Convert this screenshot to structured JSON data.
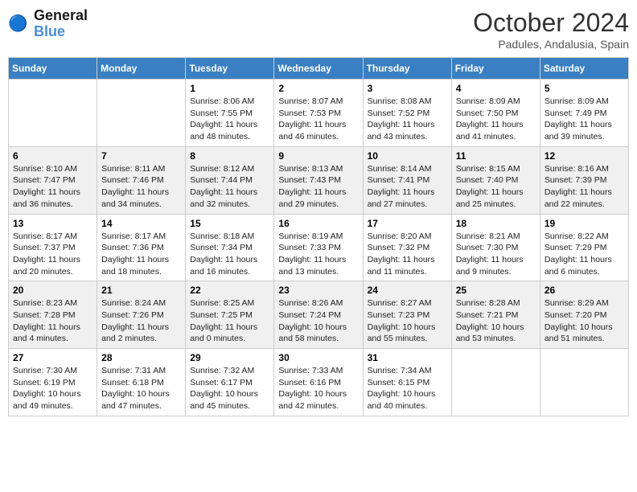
{
  "header": {
    "logo": {
      "line1": "General",
      "line2": "Blue"
    },
    "title": "October 2024",
    "location": "Padules, Andalusia, Spain"
  },
  "days_of_week": [
    "Sunday",
    "Monday",
    "Tuesday",
    "Wednesday",
    "Thursday",
    "Friday",
    "Saturday"
  ],
  "weeks": [
    [
      {
        "num": "",
        "info": ""
      },
      {
        "num": "",
        "info": ""
      },
      {
        "num": "1",
        "info": "Sunrise: 8:06 AM\nSunset: 7:55 PM\nDaylight: 11 hours and 48 minutes."
      },
      {
        "num": "2",
        "info": "Sunrise: 8:07 AM\nSunset: 7:53 PM\nDaylight: 11 hours and 46 minutes."
      },
      {
        "num": "3",
        "info": "Sunrise: 8:08 AM\nSunset: 7:52 PM\nDaylight: 11 hours and 43 minutes."
      },
      {
        "num": "4",
        "info": "Sunrise: 8:09 AM\nSunset: 7:50 PM\nDaylight: 11 hours and 41 minutes."
      },
      {
        "num": "5",
        "info": "Sunrise: 8:09 AM\nSunset: 7:49 PM\nDaylight: 11 hours and 39 minutes."
      }
    ],
    [
      {
        "num": "6",
        "info": "Sunrise: 8:10 AM\nSunset: 7:47 PM\nDaylight: 11 hours and 36 minutes."
      },
      {
        "num": "7",
        "info": "Sunrise: 8:11 AM\nSunset: 7:46 PM\nDaylight: 11 hours and 34 minutes."
      },
      {
        "num": "8",
        "info": "Sunrise: 8:12 AM\nSunset: 7:44 PM\nDaylight: 11 hours and 32 minutes."
      },
      {
        "num": "9",
        "info": "Sunrise: 8:13 AM\nSunset: 7:43 PM\nDaylight: 11 hours and 29 minutes."
      },
      {
        "num": "10",
        "info": "Sunrise: 8:14 AM\nSunset: 7:41 PM\nDaylight: 11 hours and 27 minutes."
      },
      {
        "num": "11",
        "info": "Sunrise: 8:15 AM\nSunset: 7:40 PM\nDaylight: 11 hours and 25 minutes."
      },
      {
        "num": "12",
        "info": "Sunrise: 8:16 AM\nSunset: 7:39 PM\nDaylight: 11 hours and 22 minutes."
      }
    ],
    [
      {
        "num": "13",
        "info": "Sunrise: 8:17 AM\nSunset: 7:37 PM\nDaylight: 11 hours and 20 minutes."
      },
      {
        "num": "14",
        "info": "Sunrise: 8:17 AM\nSunset: 7:36 PM\nDaylight: 11 hours and 18 minutes."
      },
      {
        "num": "15",
        "info": "Sunrise: 8:18 AM\nSunset: 7:34 PM\nDaylight: 11 hours and 16 minutes."
      },
      {
        "num": "16",
        "info": "Sunrise: 8:19 AM\nSunset: 7:33 PM\nDaylight: 11 hours and 13 minutes."
      },
      {
        "num": "17",
        "info": "Sunrise: 8:20 AM\nSunset: 7:32 PM\nDaylight: 11 hours and 11 minutes."
      },
      {
        "num": "18",
        "info": "Sunrise: 8:21 AM\nSunset: 7:30 PM\nDaylight: 11 hours and 9 minutes."
      },
      {
        "num": "19",
        "info": "Sunrise: 8:22 AM\nSunset: 7:29 PM\nDaylight: 11 hours and 6 minutes."
      }
    ],
    [
      {
        "num": "20",
        "info": "Sunrise: 8:23 AM\nSunset: 7:28 PM\nDaylight: 11 hours and 4 minutes."
      },
      {
        "num": "21",
        "info": "Sunrise: 8:24 AM\nSunset: 7:26 PM\nDaylight: 11 hours and 2 minutes."
      },
      {
        "num": "22",
        "info": "Sunrise: 8:25 AM\nSunset: 7:25 PM\nDaylight: 11 hours and 0 minutes."
      },
      {
        "num": "23",
        "info": "Sunrise: 8:26 AM\nSunset: 7:24 PM\nDaylight: 10 hours and 58 minutes."
      },
      {
        "num": "24",
        "info": "Sunrise: 8:27 AM\nSunset: 7:23 PM\nDaylight: 10 hours and 55 minutes."
      },
      {
        "num": "25",
        "info": "Sunrise: 8:28 AM\nSunset: 7:21 PM\nDaylight: 10 hours and 53 minutes."
      },
      {
        "num": "26",
        "info": "Sunrise: 8:29 AM\nSunset: 7:20 PM\nDaylight: 10 hours and 51 minutes."
      }
    ],
    [
      {
        "num": "27",
        "info": "Sunrise: 7:30 AM\nSunset: 6:19 PM\nDaylight: 10 hours and 49 minutes."
      },
      {
        "num": "28",
        "info": "Sunrise: 7:31 AM\nSunset: 6:18 PM\nDaylight: 10 hours and 47 minutes."
      },
      {
        "num": "29",
        "info": "Sunrise: 7:32 AM\nSunset: 6:17 PM\nDaylight: 10 hours and 45 minutes."
      },
      {
        "num": "30",
        "info": "Sunrise: 7:33 AM\nSunset: 6:16 PM\nDaylight: 10 hours and 42 minutes."
      },
      {
        "num": "31",
        "info": "Sunrise: 7:34 AM\nSunset: 6:15 PM\nDaylight: 10 hours and 40 minutes."
      },
      {
        "num": "",
        "info": ""
      },
      {
        "num": "",
        "info": ""
      }
    ]
  ]
}
